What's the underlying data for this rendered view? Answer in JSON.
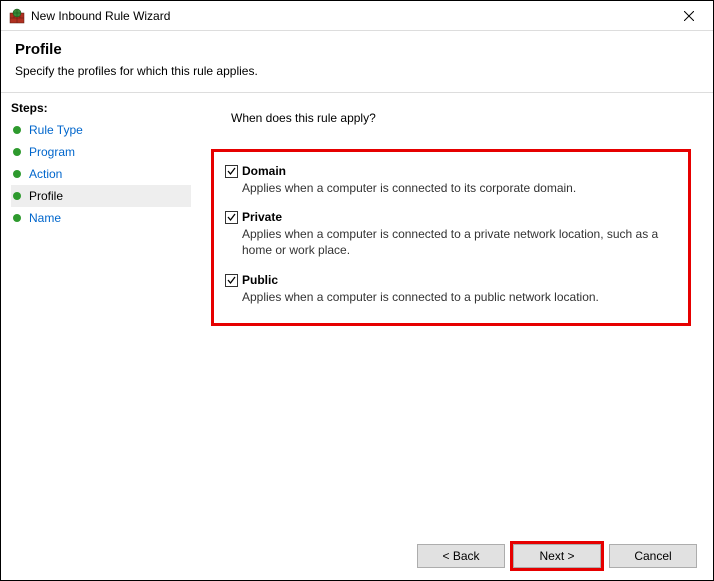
{
  "window": {
    "title": "New Inbound Rule Wizard"
  },
  "header": {
    "title": "Profile",
    "subtitle": "Specify the profiles for which this rule applies."
  },
  "sidebar": {
    "title": "Steps:",
    "items": [
      {
        "label": "Rule Type"
      },
      {
        "label": "Program"
      },
      {
        "label": "Action"
      },
      {
        "label": "Profile"
      },
      {
        "label": "Name"
      }
    ]
  },
  "content": {
    "question": "When does this rule apply?",
    "options": [
      {
        "title": "Domain",
        "desc": "Applies when a computer is connected to its corporate domain."
      },
      {
        "title": "Private",
        "desc": "Applies when a computer is connected to a private network location, such as a home or work place."
      },
      {
        "title": "Public",
        "desc": "Applies when a computer is connected to a public network location."
      }
    ]
  },
  "footer": {
    "back": "< Back",
    "next": "Next >",
    "cancel": "Cancel"
  }
}
